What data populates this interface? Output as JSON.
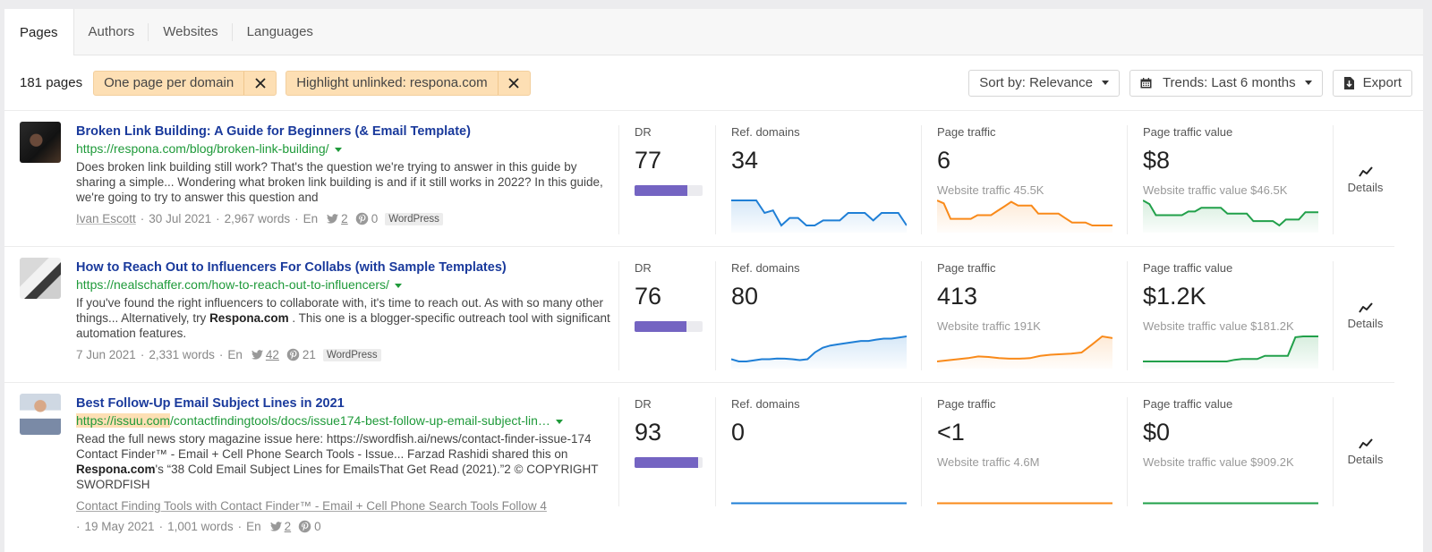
{
  "tabs": [
    {
      "label": "Pages",
      "active": true
    },
    {
      "label": "Authors",
      "active": false
    },
    {
      "label": "Websites",
      "active": false
    },
    {
      "label": "Languages",
      "active": false
    }
  ],
  "filterbar": {
    "count": "181 pages",
    "chips": [
      {
        "label": "One page per domain"
      },
      {
        "label": "Highlight unlinked: respona.com"
      }
    ],
    "sort_label": "Sort by: Relevance",
    "trends_label": "Trends: Last 6 months",
    "export_label": "Export"
  },
  "colors": {
    "ref_domains": "#1f7fd6",
    "page_traffic": "#f98a1a",
    "page_traffic_value": "#21a04a",
    "dr_bar": "#7464c2",
    "title": "#1a3a9c",
    "url": "#1f9a3a",
    "highlight": "#fddfb4"
  },
  "labels": {
    "dr": "DR",
    "ref_domains": "Ref. domains",
    "page_traffic": "Page traffic",
    "page_traffic_value": "Page traffic value",
    "details": "Details"
  },
  "rows": [
    {
      "title": "Broken Link Building: A Guide for Beginners (& Email Template)",
      "url_highlight": "",
      "url": "https://respona.com/blog/broken-link-building/",
      "desc_pre": "Does broken link building still work? That's the question we're trying to answer in this guide by sharing a simple... Wondering what broken link building is and if it still works in 2022? In this guide, we're going to try to answer this question and",
      "desc_bold": "",
      "desc_post": "",
      "related": "",
      "author": "Ivan Escott",
      "date": "30 Jul 2021",
      "words": "2,967 words",
      "lang": "En",
      "twitter": "2",
      "pinterest": "0",
      "cms": "WordPress",
      "dr": "77",
      "dr_pct": 77,
      "ref_domains": "34",
      "page_traffic": "6",
      "website_traffic": "Website traffic 45.5K",
      "page_traffic_value": "$8",
      "website_traffic_value": "Website traffic value $46.5K",
      "trend_ref": [
        35,
        35,
        35,
        35,
        34.5,
        34.6,
        34,
        34.3,
        34.3,
        34,
        34,
        34.2,
        34.2,
        34.2,
        34.5,
        34.5,
        34.5,
        34.2,
        34.5,
        34.5,
        34.5,
        34
      ],
      "trend_pt": [
        8,
        7.6,
        5.5,
        5.5,
        5.5,
        5.5,
        6,
        6,
        6,
        6.6,
        7.2,
        7.8,
        7.3,
        7.3,
        7.3,
        6.2,
        6.2,
        6.2,
        6.2,
        5.6,
        5.0,
        5.0,
        5.0,
        4.6,
        4.6,
        4.6,
        4.6
      ],
      "trend_ptv": [
        9,
        8.5,
        7,
        7,
        7,
        7,
        7,
        7.5,
        7.5,
        8,
        8,
        8,
        8,
        7.2,
        7.2,
        7.2,
        7.2,
        6.2,
        6.2,
        6.2,
        6.2,
        5.6,
        6.4,
        6.4,
        6.4,
        7.4,
        7.4,
        7.4
      ]
    },
    {
      "title": "How to Reach Out to Influencers For Collabs (with Sample Templates)",
      "url_highlight": "",
      "url": "https://nealschaffer.com/how-to-reach-out-to-influencers/",
      "desc_pre": "If you've found the right influencers to collaborate with, it's time to reach out. As with so many other things... Alternatively, try ",
      "desc_bold": "Respona.com",
      "desc_post": " . This one is a blogger-specific outreach tool with significant automation features.",
      "related": "",
      "author": "",
      "date": "7 Jun 2021",
      "words": "2,331 words",
      "lang": "En",
      "twitter": "42",
      "pinterest": "21",
      "cms": "WordPress",
      "dr": "76",
      "dr_pct": 76,
      "ref_domains": "80",
      "page_traffic": "413",
      "website_traffic": "Website traffic 191K",
      "page_traffic_value": "$1.2K",
      "website_traffic_value": "Website traffic value $181.2K",
      "trend_ref": [
        60,
        59,
        59,
        59.5,
        60,
        60,
        60.3,
        60.2,
        60,
        59.6,
        60,
        63,
        65,
        66,
        66.5,
        67,
        67.5,
        68,
        68,
        68.6,
        69,
        69,
        69.5,
        70
      ],
      "trend_pt": [
        300,
        302,
        304,
        306,
        309,
        308,
        306,
        305,
        305,
        306,
        310,
        312,
        313,
        314,
        316,
        330,
        345,
        342
      ],
      "trend_ptv": [
        400,
        400,
        400,
        400,
        400,
        400,
        400,
        400,
        400,
        400,
        400,
        400,
        420,
        430,
        430,
        430,
        470,
        470,
        470,
        470,
        700,
        710,
        710,
        710
      ]
    },
    {
      "title": "Best Follow-Up Email Subject Lines in 2021",
      "url_highlight": "https://issuu.com",
      "url": "/contactfindingtools/docs/issue174-best-follow-up-email-subject-lin…",
      "desc_pre": "Read the full news story magazine issue here: https://swordfish.ai/news/contact-finder-issue-174 Contact Finder™ - Email + Cell Phone Search Tools - Issue... Farzad Rashidi shared this on ",
      "desc_bold": "Respona.com",
      "desc_post": "'s “38 Cold Email Subject Lines for EmailsThat Get Read (2021).”2 © COPYRIGHT SWORDFISH",
      "related": "Contact Finding Tools with Contact Finder™ - Email + Cell Phone Search Tools Follow 4",
      "author": "",
      "date": "19 May 2021",
      "words": "1,001 words",
      "lang": "En",
      "twitter": "2",
      "pinterest": "0",
      "cms": "",
      "dr": "93",
      "dr_pct": 93,
      "ref_domains": "0",
      "page_traffic": "<1",
      "website_traffic": "Website traffic 4.6M",
      "page_traffic_value": "$0",
      "website_traffic_value": "Website traffic value $909.2K",
      "trend_ref": [
        0,
        0
      ],
      "trend_pt": [
        0,
        0
      ],
      "trend_ptv": [
        0,
        0
      ]
    }
  ]
}
